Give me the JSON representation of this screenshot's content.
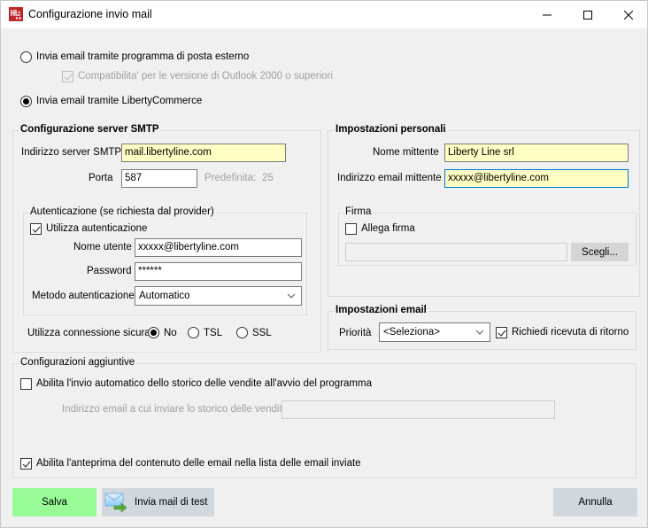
{
  "window": {
    "title": "Configurazione invio mail",
    "controls": {
      "minimize": "minimize",
      "maximize": "maximize",
      "close": "close"
    }
  },
  "send_mode": {
    "external_label": "Invia email tramite programma di posta esterno",
    "external_selected": false,
    "outlook_compat_label": "Compatibilita' per le versione di Outlook 2000 o superiori",
    "outlook_compat_checked": true,
    "outlook_compat_enabled": false,
    "liberty_label": "Invia email tramite LibertyCommerce",
    "liberty_selected": true
  },
  "smtp": {
    "title": "Configurazione server SMTP",
    "server_label": "Indirizzo server SMTP",
    "server_value": "mail.libertyline.com",
    "port_label": "Porta",
    "port_value": "587",
    "default_port_label": "Predefinita:",
    "default_port_value": "25",
    "auth": {
      "title": "Autenticazione (se richiesta dal provider)",
      "use_auth_label": "Utilizza autenticazione",
      "use_auth_checked": true,
      "username_label": "Nome utente",
      "username_value": "xxxxx@libertyline.com",
      "password_label": "Password",
      "password_value": "******",
      "method_label": "Metodo autenticazione",
      "method_value": "Automatico"
    },
    "secure": {
      "label": "Utilizza connessione sicura",
      "options": [
        {
          "label": "No",
          "selected": true
        },
        {
          "label": "TSL",
          "selected": false
        },
        {
          "label": "SSL",
          "selected": false
        }
      ]
    }
  },
  "personal": {
    "title": "Impostazioni personali",
    "sender_name_label": "Nome mittente",
    "sender_name_value": "Liberty Line srl",
    "sender_email_label": "Indirizzo email mittente",
    "sender_email_value": "xxxxx@libertyline.com",
    "signature": {
      "title": "Firma",
      "attach_label": "Allega firma",
      "attach_checked": false,
      "path_value": "",
      "choose_label": "Scegli..."
    }
  },
  "email_settings": {
    "title": "Impostazioni email",
    "priority_label": "Priorità",
    "priority_value": "<Seleziona>",
    "receipt_label": "Richiedi ricevuta di ritorno",
    "receipt_checked": true
  },
  "additional": {
    "title": "Configurazioni aggiuntive",
    "auto_history_label": "Abilita l'invio automatico dello storico delle vendite all'avvio del programma",
    "auto_history_checked": false,
    "history_email_label": "Indirizzo email a cui inviare lo storico delle vendite",
    "history_email_value": "",
    "preview_label": "Abilita l'anteprima del contenuto delle email nella lista delle email inviate",
    "preview_checked": true
  },
  "buttons": {
    "save": "Salva",
    "test": "Invia mail di test",
    "cancel": "Annulla"
  },
  "colors": {
    "save_bg": "#98fb98",
    "test_bg": "#d0d8de",
    "cancel_bg": "#d0d8de",
    "input_highlight": "#ffffc4",
    "app_icon": "#c0272d"
  }
}
